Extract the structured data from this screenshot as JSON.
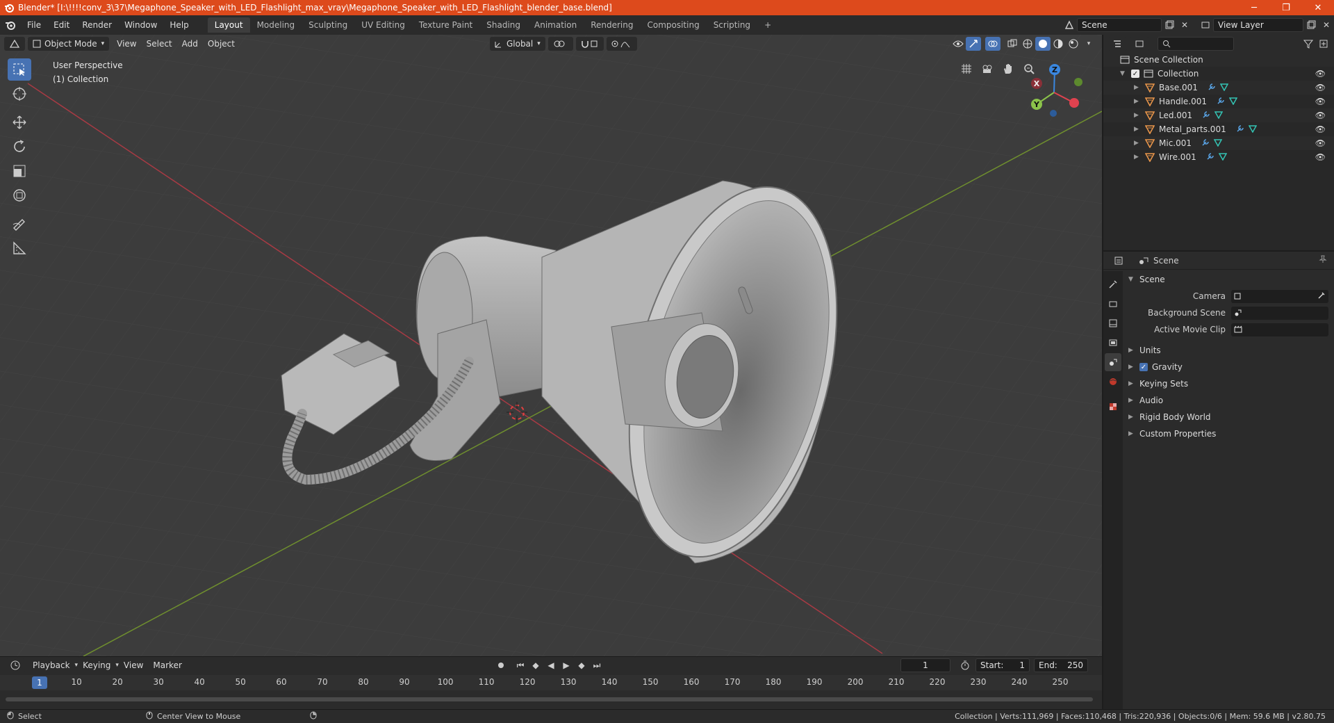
{
  "window": {
    "title": "Blender* [I:\\!!!!conv_3\\37\\Megaphone_Speaker_with_LED_Flashlight_max_vray\\Megaphone_Speaker_with_LED_Flashlight_blender_base.blend]",
    "minimize": "─",
    "maximize": "❐",
    "close": "✕"
  },
  "menu": {
    "file": "File",
    "edit": "Edit",
    "render": "Render",
    "window": "Window",
    "help": "Help"
  },
  "workspaces": [
    "Layout",
    "Modeling",
    "Sculpting",
    "UV Editing",
    "Texture Paint",
    "Shading",
    "Animation",
    "Rendering",
    "Compositing",
    "Scripting"
  ],
  "add_workspace": "+",
  "scene_field": "Scene",
  "view_layer_field": "View Layer",
  "viewport": {
    "mode": "Object Mode",
    "menus": [
      "View",
      "Select",
      "Add",
      "Object"
    ],
    "orientation": "Global",
    "perspective": "User Perspective",
    "collection": "(1) Collection",
    "gizmo": {
      "x": "X",
      "y": "Y",
      "z": "Z"
    }
  },
  "outliner": {
    "root": "Scene Collection",
    "collection": "Collection",
    "objects": [
      "Base.001",
      "Handle.001",
      "Led.001",
      "Metal_parts.001",
      "Mic.001",
      "Wire.001"
    ]
  },
  "properties": {
    "header": "Scene",
    "section": "Scene",
    "camera_label": "Camera",
    "background_scene_label": "Background Scene",
    "active_movie_clip_label": "Active Movie Clip",
    "panels": [
      "Units",
      "Gravity",
      "Keying Sets",
      "Audio",
      "Rigid Body World",
      "Custom Properties"
    ]
  },
  "timeline": {
    "menus": [
      "Playback",
      "Keying",
      "View",
      "Marker"
    ],
    "current_frame": "1",
    "start_label": "Start:",
    "start": "1",
    "end_label": "End:",
    "end": "250",
    "ticks": [
      "1",
      "10",
      "20",
      "30",
      "40",
      "50",
      "60",
      "70",
      "80",
      "90",
      "100",
      "110",
      "120",
      "130",
      "140",
      "150",
      "160",
      "170",
      "180",
      "190",
      "200",
      "210",
      "220",
      "230",
      "240",
      "250"
    ]
  },
  "status": {
    "select": "Select",
    "center_view": "Center View to Mouse",
    "stats": "Collection | Verts:111,969 | Faces:110,468 | Tris:220,936 | Objects:0/6 | Mem: 59.6 MB | v2.80.75"
  },
  "colors": {
    "accent": "#4772b3",
    "titlebar": "#dd4a1c",
    "x_axis": "#e0424f",
    "y_axis": "#8bc34a",
    "z_axis": "#3a87e0",
    "mesh_icon": "#e8954a",
    "modifier_icon": "#5aa6e8",
    "data_icon": "#34c4b4"
  }
}
